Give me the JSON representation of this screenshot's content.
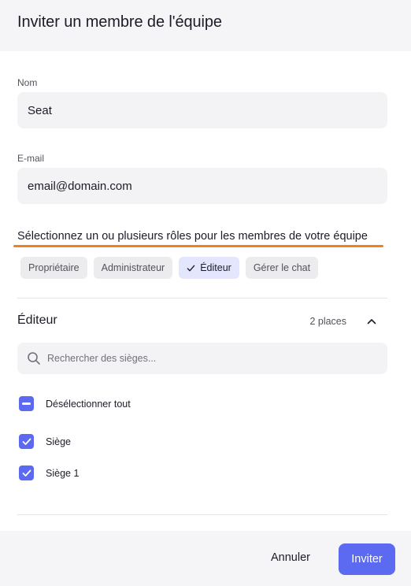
{
  "dialog": {
    "title": "Inviter un membre de l'équipe"
  },
  "form": {
    "name_label": "Nom",
    "name_value": "Seat",
    "email_label": "E-mail",
    "email_value": "email@domain.com"
  },
  "roles": {
    "heading": "Sélectionnez un ou plusieurs rôles pour les membres de votre équipe",
    "chips": [
      {
        "label": "Propriétaire",
        "selected": false
      },
      {
        "label": "Administrateur",
        "selected": false
      },
      {
        "label": "Éditeur",
        "selected": true
      },
      {
        "label": "Gérer le chat",
        "selected": false
      }
    ]
  },
  "section": {
    "title": "Éditeur",
    "places": "2 places",
    "expanded": true,
    "search_placeholder": "Rechercher des sièges...",
    "deselect_all_label": "Désélectionner tout",
    "seats": [
      {
        "label": "Siège",
        "checked": true
      },
      {
        "label": "Siège 1",
        "checked": true
      }
    ]
  },
  "footer": {
    "cancel_label": "Annuler",
    "invite_label": "Inviter"
  },
  "colors": {
    "accent": "#5b6af0",
    "highlight_underline": "#f0821e",
    "selected_chip_bg": "#e3e6fc"
  },
  "icons": {
    "chip_selected": "check-icon",
    "collapse": "chevron-up-icon",
    "search": "search-icon",
    "deselect_all": "minus-checkbox-icon",
    "seat": "checkbox-checked-icon"
  }
}
